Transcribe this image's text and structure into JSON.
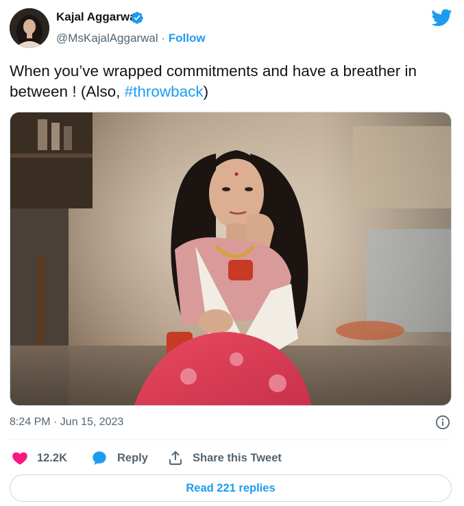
{
  "author": {
    "name": "Kajal Aggarwal",
    "handle": "@MsKajalAggarwal",
    "separator": "·",
    "follow_label": "Follow"
  },
  "tweet": {
    "text_before": "When you’ve wrapped commitments and have a breather in between ! (Also, ",
    "hashtag": "#throwback",
    "text_after": ")"
  },
  "meta": {
    "timestamp": "8:24 PM · Jun 15, 2023"
  },
  "actions": {
    "like_count": "12.2K",
    "reply_label": "Reply",
    "share_label": "Share this Tweet"
  },
  "footer": {
    "read_replies_label": "Read 221 replies"
  },
  "colors": {
    "accent": "#1d9bf0",
    "like": "#f91880",
    "text": "#0f1419",
    "muted": "#536471"
  },
  "icons": [
    "verified-badge-icon",
    "twitter-bird-icon",
    "info-icon",
    "heart-icon",
    "reply-bubble-icon",
    "share-icon"
  ]
}
